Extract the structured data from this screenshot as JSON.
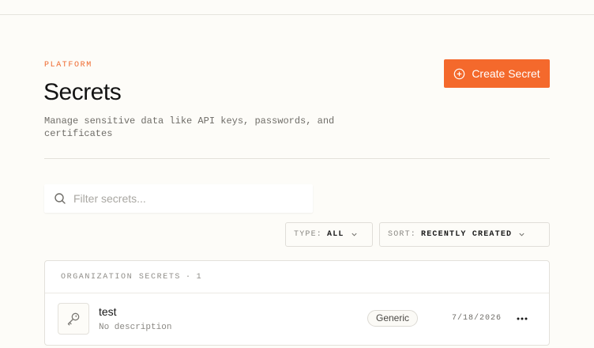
{
  "header": {
    "eyebrow": "PLATFORM",
    "title": "Secrets",
    "description": "Manage sensitive data like API keys, passwords, and certificates",
    "create_label": "Create Secret"
  },
  "search": {
    "placeholder": "Filter secrets...",
    "value": ""
  },
  "filters": {
    "type_key": "TYPE:",
    "type_value": "ALL",
    "sort_key": "SORT:",
    "sort_value": "RECENTLY CREATED"
  },
  "panel": {
    "heading": "ORGANIZATION SECRETS",
    "separator": "·",
    "count": "1",
    "rows": [
      {
        "name": "test",
        "description": "No description",
        "type": "Generic",
        "date": "7/18/2026"
      }
    ]
  },
  "colors": {
    "accent": "#f4692c",
    "background": "#fdfcf8"
  },
  "icons": {
    "create": "plus-circle-icon",
    "search": "search-icon",
    "chevron": "chevron-down-icon",
    "secret": "key-icon",
    "more": "more-horizontal-icon"
  }
}
